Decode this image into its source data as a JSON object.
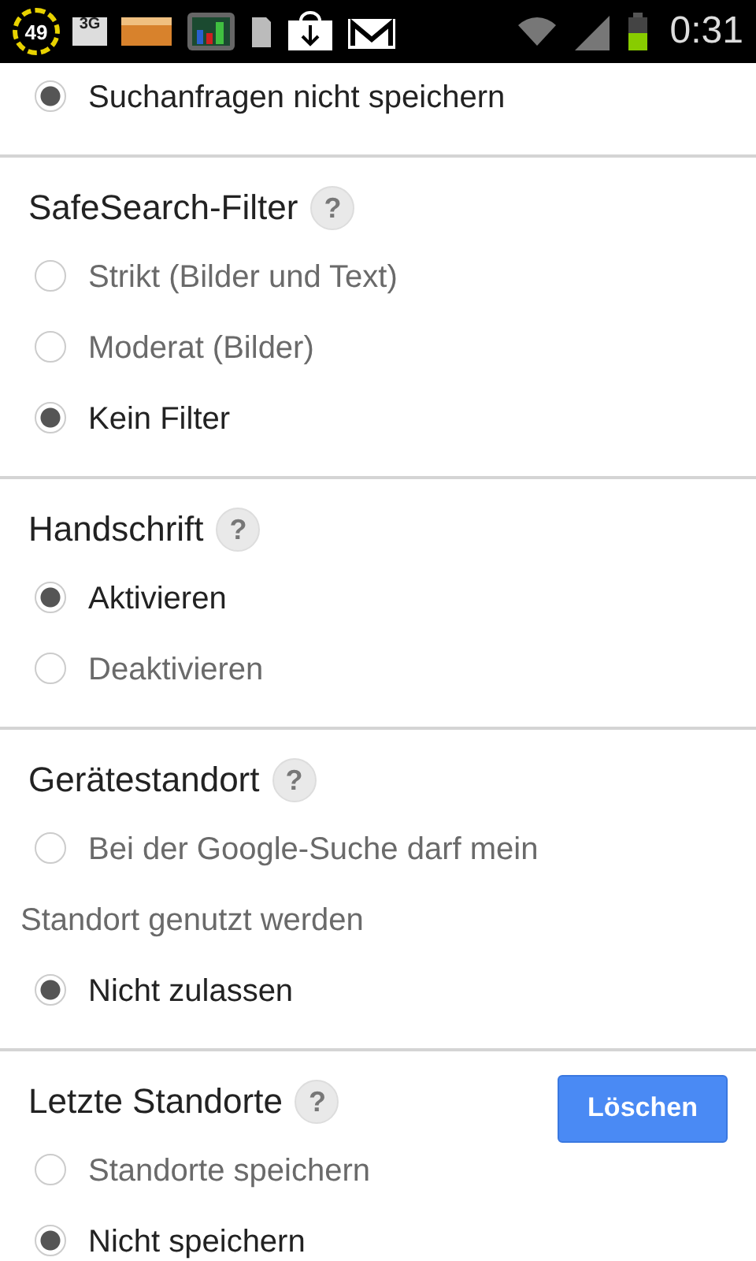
{
  "status_bar": {
    "battery_badge": "49",
    "network": "3G",
    "time": "0:31"
  },
  "sections": [
    {
      "options": [
        {
          "label": "Suchanfragen nicht speichern",
          "selected": true
        }
      ]
    },
    {
      "title": "SafeSearch-Filter",
      "help": "?",
      "options": [
        {
          "label": "Strikt (Bilder und Text)",
          "selected": false
        },
        {
          "label": "Moderat (Bilder)",
          "selected": false
        },
        {
          "label": "Kein Filter",
          "selected": true
        }
      ]
    },
    {
      "title": "Handschrift",
      "help": "?",
      "options": [
        {
          "label": "Aktivieren",
          "selected": true
        },
        {
          "label": "Deaktivieren",
          "selected": false
        }
      ]
    },
    {
      "title": "Gerätestandort",
      "help": "?",
      "options": [
        {
          "label": "Bei der Google-Suche darf mein",
          "label_continued": "Standort genutzt werden",
          "selected": false
        },
        {
          "label": "Nicht zulassen",
          "selected": true
        }
      ]
    },
    {
      "title": "Letzte Standorte",
      "help": "?",
      "button": "Löschen",
      "options": [
        {
          "label": "Standorte speichern",
          "selected": false
        },
        {
          "label": "Nicht speichern",
          "selected": true
        }
      ]
    }
  ]
}
